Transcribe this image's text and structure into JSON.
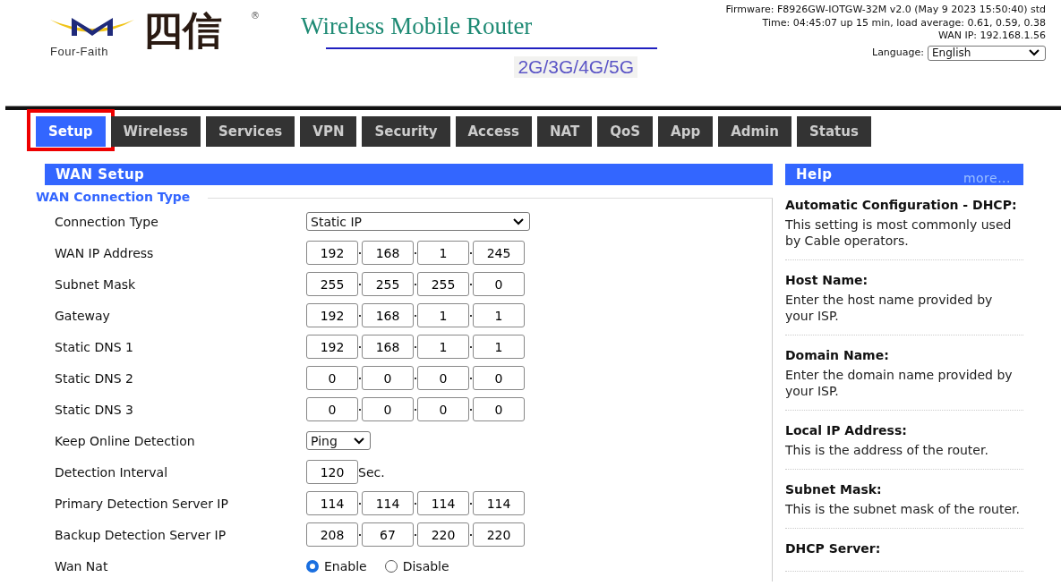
{
  "header": {
    "brand": "Four-Faith",
    "brand_cn": "四信",
    "registered": "®",
    "title": "Wireless Mobile Router",
    "subtitle": "2G/3G/4G/5G",
    "status_lines": [
      "Firmware: F8926GW-IOTGW-32M v2.0 (May 9 2023 15:50:40) std",
      "Time: 04:45:07 up 15 min, load average: 0.61, 0.59, 0.38",
      "WAN IP: 192.168.1.56"
    ],
    "language": {
      "label": "Language:",
      "value": "English"
    }
  },
  "tabs": [
    {
      "label": "Setup",
      "selected": true,
      "highlighted": true
    },
    {
      "label": "Wireless",
      "selected": false,
      "highlighted": false
    },
    {
      "label": "Services",
      "selected": false,
      "highlighted": false
    },
    {
      "label": "VPN",
      "selected": false,
      "highlighted": false
    },
    {
      "label": "Security",
      "selected": false,
      "highlighted": false
    },
    {
      "label": "Access",
      "selected": false,
      "highlighted": false
    },
    {
      "label": "NAT",
      "selected": false,
      "highlighted": false
    },
    {
      "label": "QoS",
      "selected": false,
      "highlighted": false
    },
    {
      "label": "App",
      "selected": false,
      "highlighted": false
    },
    {
      "label": "Admin",
      "selected": false,
      "highlighted": false
    },
    {
      "label": "Status",
      "selected": false,
      "highlighted": false
    }
  ],
  "main": {
    "title": "WAN Setup",
    "section": "WAN Connection Type",
    "rows": [
      {
        "kind": "select",
        "label": "Connection Type",
        "value": "Static IP"
      },
      {
        "kind": "ip",
        "label": "WAN IP Address",
        "octets": [
          "192",
          "168",
          "1",
          "245"
        ]
      },
      {
        "kind": "ip",
        "label": "Subnet Mask",
        "octets": [
          "255",
          "255",
          "255",
          "0"
        ]
      },
      {
        "kind": "ip",
        "label": "Gateway",
        "octets": [
          "192",
          "168",
          "1",
          "1"
        ]
      },
      {
        "kind": "ip",
        "label": "Static DNS 1",
        "octets": [
          "192",
          "168",
          "1",
          "1"
        ]
      },
      {
        "kind": "ip",
        "label": "Static DNS 2",
        "octets": [
          "0",
          "0",
          "0",
          "0"
        ]
      },
      {
        "kind": "ip",
        "label": "Static DNS 3",
        "octets": [
          "0",
          "0",
          "0",
          "0"
        ]
      },
      {
        "kind": "small-select",
        "label": "Keep Online Detection",
        "value": "Ping"
      },
      {
        "kind": "number",
        "label": "Detection Interval",
        "value": "120",
        "unit": "Sec."
      },
      {
        "kind": "ip",
        "label": "Primary Detection Server IP",
        "octets": [
          "114",
          "114",
          "114",
          "114"
        ]
      },
      {
        "kind": "ip",
        "label": "Backup Detection Server IP",
        "octets": [
          "208",
          "67",
          "220",
          "220"
        ]
      },
      {
        "kind": "radio",
        "label": "Wan Nat",
        "options": [
          {
            "label": "Enable",
            "selected": true
          },
          {
            "label": "Disable",
            "selected": false
          }
        ]
      }
    ]
  },
  "help": {
    "title": "Help",
    "more": "more...",
    "items": [
      {
        "term": "Automatic Configuration - DHCP:",
        "text": "This setting is most commonly used by Cable operators."
      },
      {
        "term": "Host Name:",
        "text": "Enter the host name provided by your ISP."
      },
      {
        "term": "Domain Name:",
        "text": "Enter the domain name provided by your ISP."
      },
      {
        "term": "Local IP Address:",
        "text": "This is the address of the router."
      },
      {
        "term": "Subnet Mask:",
        "text": "This is the subnet mask of the router."
      },
      {
        "term": "DHCP Server:"
      }
    ]
  }
}
